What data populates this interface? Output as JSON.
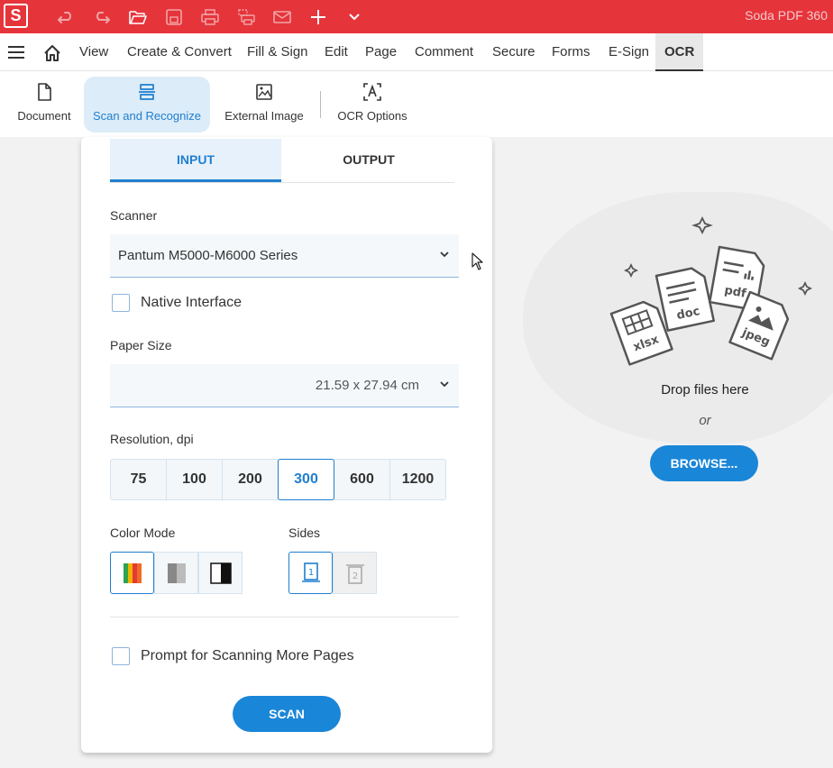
{
  "app": {
    "logo_letter": "S",
    "title": "Soda PDF 360",
    "brand_color": "#e6343b",
    "accent_color": "#1f7fcf"
  },
  "toolbar": {
    "icons": [
      "undo-icon",
      "redo-icon",
      "open-folder-icon",
      "save-icon",
      "print-icon",
      "scan-print-icon",
      "email-icon",
      "add-icon",
      "chevron-down-icon"
    ]
  },
  "menu": {
    "items": [
      "View",
      "Create & Convert",
      "Fill & Sign",
      "Edit",
      "Page",
      "Comment",
      "Secure",
      "Forms",
      "E-Sign",
      "OCR"
    ],
    "active": "OCR"
  },
  "ribbon": {
    "buttons": [
      {
        "label": "Document",
        "icon": "document-icon"
      },
      {
        "label": "Scan and Recognize",
        "icon": "scanner-icon"
      },
      {
        "label": "External Image",
        "icon": "image-icon"
      },
      {
        "label": "OCR Options",
        "icon": "ocr-options-icon"
      }
    ],
    "active": "Scan and Recognize"
  },
  "panel": {
    "tabs": [
      "INPUT",
      "OUTPUT"
    ],
    "active_tab": "INPUT",
    "scanner_label": "Scanner",
    "scanner_value": "Pantum M5000-M6000 Series",
    "native_interface_label": "Native Interface",
    "native_interface_checked": false,
    "paper_size_label": "Paper Size",
    "paper_size_value": "21.59 x 27.94 cm",
    "resolution_label": "Resolution, dpi",
    "resolutions": [
      "75",
      "100",
      "200",
      "300",
      "600",
      "1200"
    ],
    "resolution_selected": "300",
    "color_mode_label": "Color Mode",
    "color_modes": [
      "color",
      "grayscale",
      "black-and-white"
    ],
    "color_mode_selected": "color",
    "sides_label": "Sides",
    "sides": [
      "single-sided",
      "double-sided"
    ],
    "sides_selected": "single-sided",
    "prompt_label": "Prompt for Scanning More Pages",
    "prompt_checked": false,
    "scan_label": "SCAN"
  },
  "dropzone": {
    "text": "Drop files here",
    "or": "or",
    "browse_label": "BROWSE...",
    "file_types": [
      "xlsx",
      "doc",
      "pdf",
      "jpeg"
    ]
  }
}
